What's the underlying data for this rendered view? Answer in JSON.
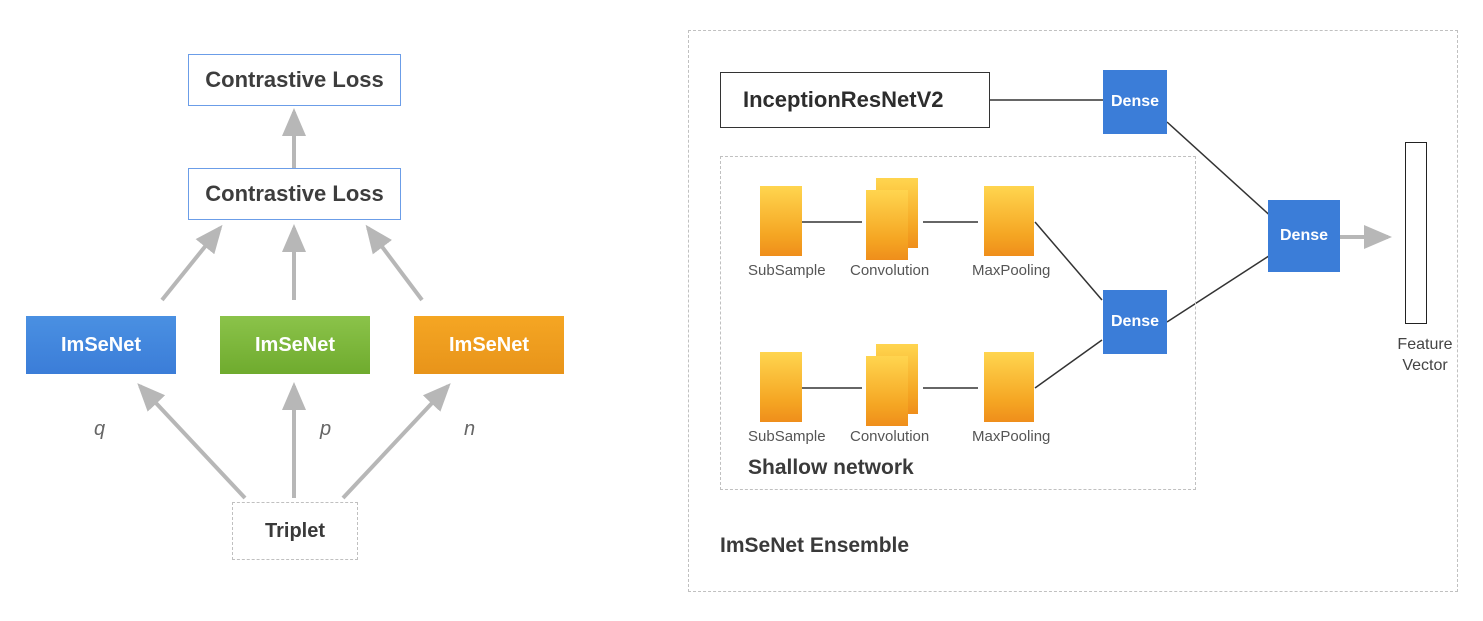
{
  "left": {
    "loss1": "Contrastive Loss",
    "loss2": "Contrastive Loss",
    "net1": "ImSeNet",
    "net2": "ImSeNet",
    "net3": "ImSeNet",
    "q": "q",
    "p": "p",
    "n": "n",
    "triplet": "Triplet"
  },
  "right": {
    "inception": "InceptionResNetV2",
    "dense": "Dense",
    "shallow_title": "Shallow network",
    "ensemble_title": "ImSeNet Ensemble",
    "subsample": "SubSample",
    "convolution": "Convolution",
    "maxpooling": "MaxPooling",
    "feature": "Feature\nVector"
  }
}
